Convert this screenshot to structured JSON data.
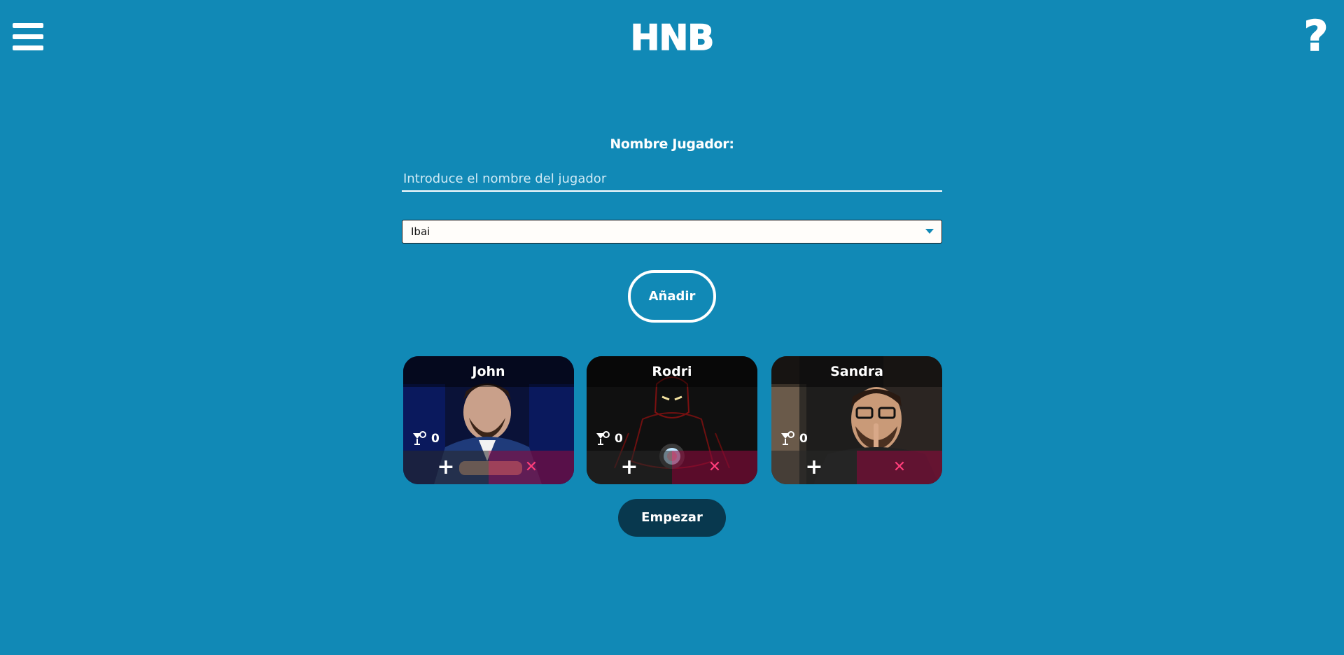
{
  "header": {
    "logo_text": "HNB",
    "menu_icon": "hamburger-menu-icon",
    "help_text": "?"
  },
  "form": {
    "label": "Nombre Jugador:",
    "name_input": {
      "value": "",
      "placeholder": "Introduce el nombre del jugador"
    },
    "character_select": {
      "selected": "Ibai"
    },
    "add_button_label": "Añadir"
  },
  "players": [
    {
      "name": "John",
      "drinks": "0",
      "plus_label": "+",
      "remove_label": "✕"
    },
    {
      "name": "Rodri",
      "drinks": "0",
      "plus_label": "+",
      "remove_label": "✕"
    },
    {
      "name": "Sandra",
      "drinks": "0",
      "plus_label": "+",
      "remove_label": "✕"
    }
  ],
  "start_button_label": "Empezar",
  "colors": {
    "background": "#1189b6",
    "start_button": "#08384e",
    "remove_accent": "#ff3d7a"
  }
}
